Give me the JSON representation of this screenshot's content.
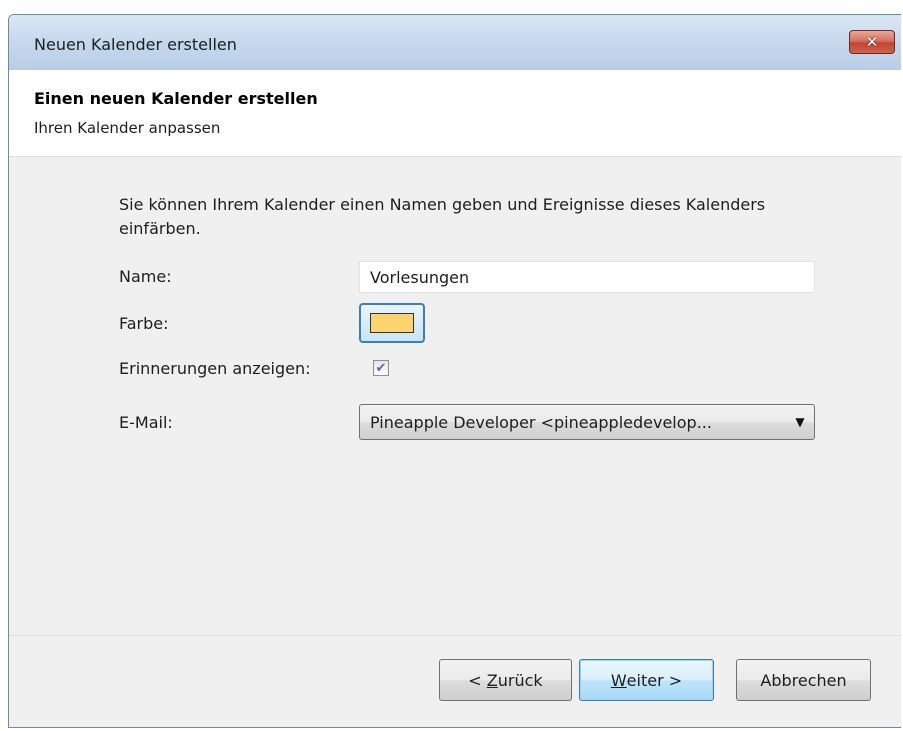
{
  "window": {
    "title": "Neuen Kalender erstellen",
    "close_label": "✕"
  },
  "header": {
    "title": "Einen neuen Kalender erstellen",
    "subtitle": "Ihren Kalender anpassen"
  },
  "form": {
    "description": "Sie können Ihrem Kalender einen Namen geben und Ereignisse dieses Kalenders einfärben.",
    "name_label": "Name:",
    "name_value": "Vorlesungen",
    "color_label": "Farbe:",
    "color_value": "#fcd46e",
    "reminders_label": "Erinnerungen anzeigen:",
    "reminders_checked": true,
    "email_label": "E-Mail:",
    "email_value": "Pineapple Developer <pineappledevelop..."
  },
  "buttons": {
    "back_prefix": "< ",
    "back_mnemonic": "Z",
    "back_rest": "urück",
    "next_mnemonic": "W",
    "next_rest": "eiter >",
    "cancel_label": "Abbrechen"
  },
  "icons": {
    "close": "close-icon",
    "checkmark": "checkmark-icon",
    "dropdown": "chevron-down-icon"
  }
}
